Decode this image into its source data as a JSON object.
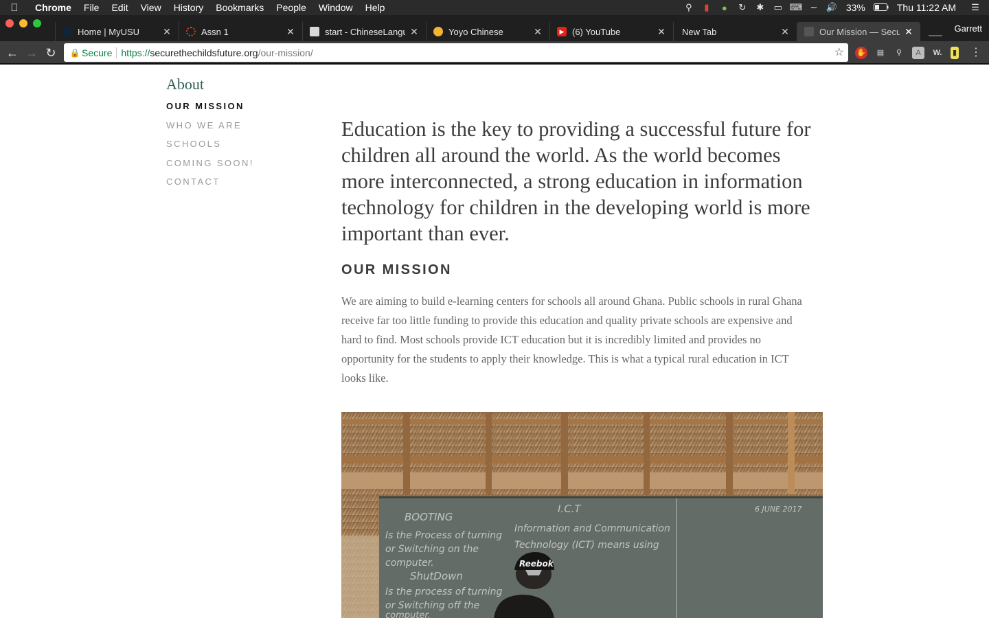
{
  "menubar": {
    "app": "Chrome",
    "items": [
      "File",
      "Edit",
      "View",
      "History",
      "Bookmarks",
      "People",
      "Window",
      "Help"
    ],
    "battery": "33%",
    "clock": "Thu 11:22 AM"
  },
  "tabs": [
    {
      "label": "Home | MyUSU",
      "favicon_color": "#0f2439"
    },
    {
      "label": "Assn 1",
      "favicon_color": "#d33b2c"
    },
    {
      "label": "start - ChineseLangua",
      "favicon_color": "#d8d8d8"
    },
    {
      "label": "Yoyo Chinese",
      "favicon_color": "#f2b52d"
    },
    {
      "label": "(6) YouTube",
      "favicon_color": "#e62117"
    },
    {
      "label": "New Tab",
      "favicon_color": ""
    },
    {
      "label": "Our Mission — Secure",
      "favicon_color": "#555555",
      "active": true
    }
  ],
  "profile": "Garrett",
  "omnibox": {
    "secure_label": "Secure",
    "scheme": "https://",
    "host": "securethechildsfuture.org",
    "path": "/our-mission/"
  },
  "sidebar": {
    "title": "About",
    "items": [
      {
        "label": "Our Mission",
        "active": true
      },
      {
        "label": "Who We Are"
      },
      {
        "label": "Schools"
      },
      {
        "label": "Coming Soon!"
      },
      {
        "label": "Contact"
      }
    ]
  },
  "main": {
    "lead": "Education is the key to providing a successful future for children all around the world. As the world becomes more interconnected, a strong education in information technology for children in the developing world is more important than ever.",
    "heading": "Our Mission",
    "body": "We are aiming to build e-learning centers for schools all around Ghana. Public schools in rural Ghana receive far too little funding to provide this education and quality private schools are expensive and hard to find. Most schools provide ICT education but it is incredibly limited and provides no opportunity for the students to apply their knowledge. This is what a typical rural education in ICT looks like.",
    "photo": {
      "blackboard_lines": [
        "BOOTING",
        "Is the Process of turning",
        "or Switching on the",
        "computer.",
        "ShutDown",
        "Is the process of turning",
        "or Switching off the",
        "computer."
      ],
      "blackboard_right": [
        "I.C.T",
        "Information and Communication",
        "Technology (ICT) means using"
      ],
      "date": "6 JUNE 2017",
      "cap_text": "Reebok"
    }
  },
  "colors": {
    "accent": "#2f5f54",
    "secure_green": "#0b8043"
  }
}
